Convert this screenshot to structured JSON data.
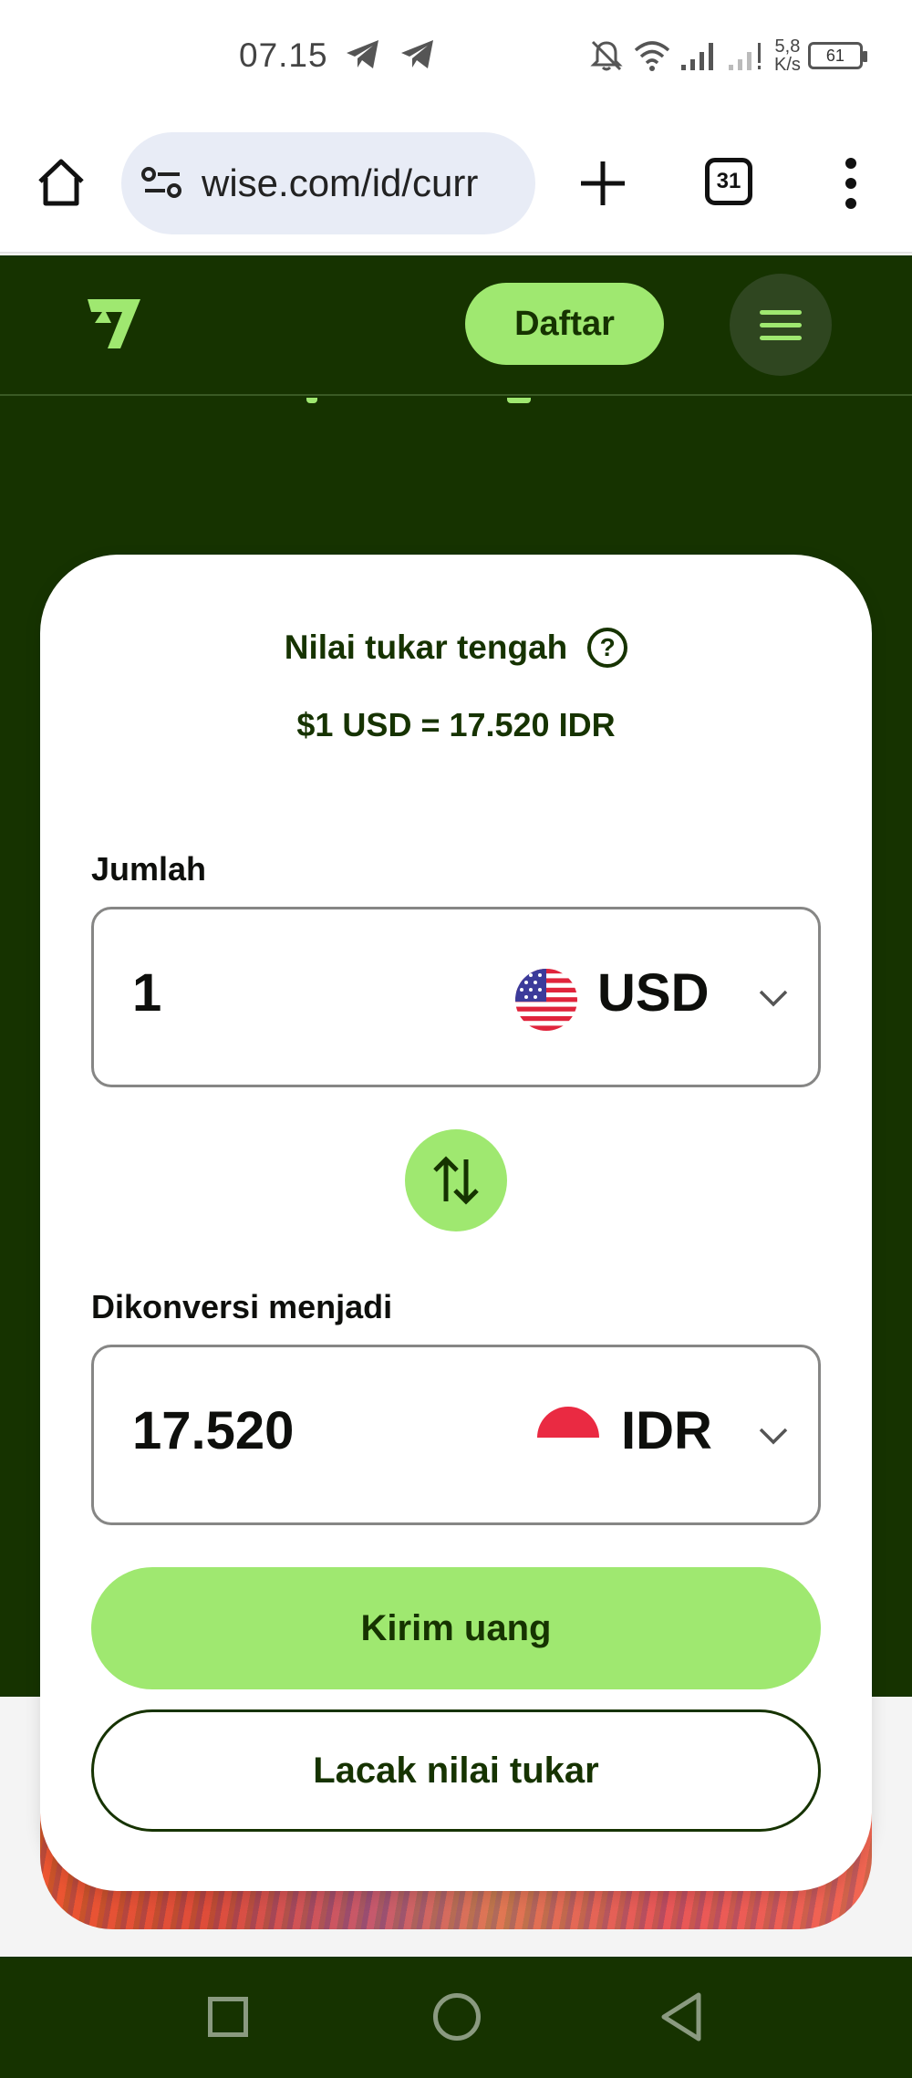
{
  "status_bar": {
    "time": "07.15",
    "net_speed_value": "5,8",
    "net_speed_unit": "K/s",
    "battery": "61"
  },
  "browser": {
    "url": "wise.com/id/curr",
    "tab_count": "31"
  },
  "header": {
    "signup_label": "Daftar"
  },
  "converter": {
    "rate_title": "Nilai tukar tengah",
    "help_symbol": "?",
    "rate_value": "$1 USD = 17.520 IDR",
    "amount_label": "Jumlah",
    "amount_value": "1",
    "from_currency": "USD",
    "converted_label": "Dikonversi menjadi",
    "converted_value": "17.520",
    "to_currency": "IDR",
    "send_label": "Kirim uang",
    "track_label": "Lacak nilai tukar"
  },
  "colors": {
    "brand_dark": "#163300",
    "brand_green": "#9fe870"
  },
  "icons": [
    "telegram-icon",
    "mute-icon",
    "wifi-icon",
    "signal-icon",
    "battery-icon",
    "home-icon",
    "site-settings-icon",
    "plus-icon",
    "tabs-icon",
    "more-vert-icon",
    "wise-logo-icon",
    "hamburger-icon",
    "help-icon",
    "us-flag-icon",
    "id-flag-icon",
    "chevron-down-icon",
    "swap-icon",
    "nav-recent-icon",
    "nav-home-icon",
    "nav-back-icon"
  ]
}
